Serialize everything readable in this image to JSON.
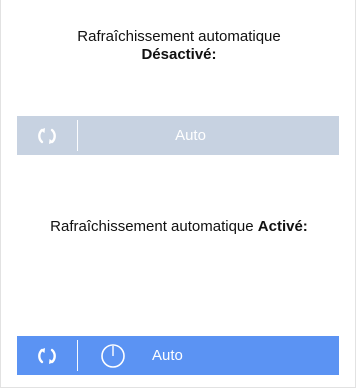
{
  "disabled_section": {
    "caption_prefix": "Rafraîchissement automatique",
    "caption_state": "Désactivé:",
    "auto_label": "Auto",
    "bar_color": "#c7d2e1",
    "refresh_icon": "refresh-icon"
  },
  "enabled_section": {
    "caption_prefix": "Rafraîchissement automatique",
    "caption_state": "Activé:",
    "auto_label": "Auto",
    "bar_color": "#5b93f3",
    "refresh_icon": "refresh-icon",
    "timer_icon": "timer-icon"
  }
}
